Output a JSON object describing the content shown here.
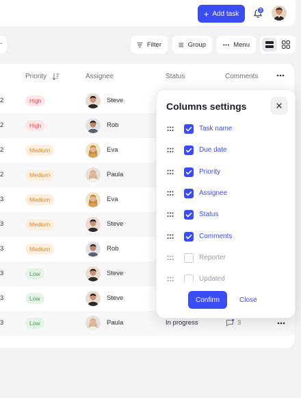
{
  "topbar": {
    "add_task_label": "Add task",
    "notification_count": "3"
  },
  "toolbar": {
    "left_pill_text": "-",
    "filter_label": "Filter",
    "group_label": "Group",
    "menu_label": "Menu"
  },
  "table": {
    "headers": {
      "priority": "Priority",
      "assignee": "Assignee",
      "status": "Status",
      "comments": "Comments"
    },
    "rows": [
      {
        "num": "2",
        "priority": "High",
        "level": "high",
        "assignee": "Steve"
      },
      {
        "num": "2",
        "priority": "High",
        "level": "high",
        "assignee": "Rob"
      },
      {
        "num": "2",
        "priority": "Medium",
        "level": "medium",
        "assignee": "Eva"
      },
      {
        "num": "2",
        "priority": "Medium",
        "level": "medium",
        "assignee": "Paula"
      },
      {
        "num": "3",
        "priority": "Medium",
        "level": "medium",
        "assignee": "Eva"
      },
      {
        "num": "3",
        "priority": "Medium",
        "level": "medium",
        "assignee": "Steve"
      },
      {
        "num": "3",
        "priority": "Medium",
        "level": "medium",
        "assignee": "Rob"
      },
      {
        "num": "3",
        "priority": "Low",
        "level": "low",
        "assignee": "Steve"
      },
      {
        "num": "3",
        "priority": "Low",
        "level": "low",
        "assignee": "Steve"
      },
      {
        "num": "3",
        "priority": "Low",
        "level": "low",
        "assignee": "Paula",
        "status": "In progress",
        "comments": "3"
      }
    ]
  },
  "modal": {
    "title": "Columns settings",
    "columns": [
      {
        "label": "Task name",
        "checked": true
      },
      {
        "label": "Due date",
        "checked": true
      },
      {
        "label": "Priority",
        "checked": true
      },
      {
        "label": "Assignee",
        "checked": true
      },
      {
        "label": "Status",
        "checked": true
      },
      {
        "label": "Comments",
        "checked": true
      },
      {
        "label": "Reporter",
        "checked": false
      },
      {
        "label": "Updated",
        "checked": false
      }
    ],
    "confirm_label": "Confirm",
    "close_label": "Close"
  },
  "colors": {
    "accent": "#3a4cf4",
    "high_bg": "#fde6e8",
    "high_fg": "#e04a55",
    "medium_bg": "#fdeedd",
    "medium_fg": "#e0862c",
    "low_bg": "#e4f5e8",
    "low_fg": "#3d9b56"
  }
}
